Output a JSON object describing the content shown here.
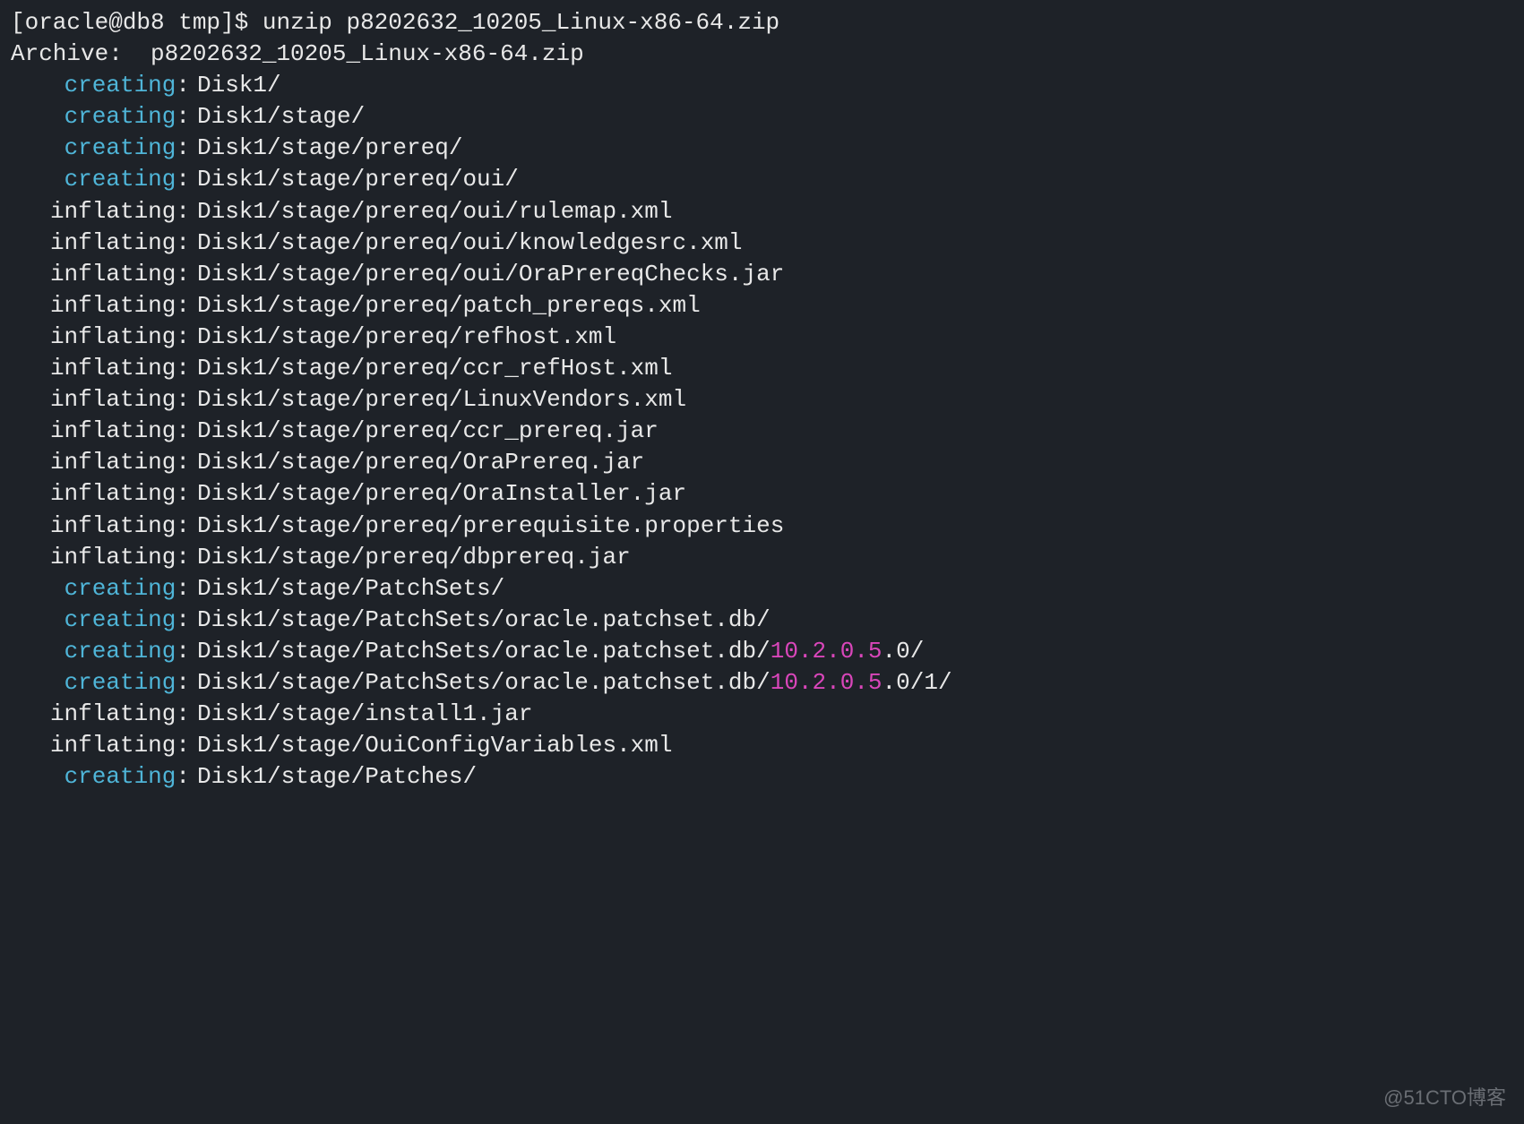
{
  "prompt": "[oracle@db8 tmp]$ ",
  "command": "unzip p8202632_10205_Linux-x86-64.zip",
  "archive_line": "Archive:  p8202632_10205_Linux-x86-64.zip",
  "lines": [
    {
      "action": "creating",
      "path": "Disk1/"
    },
    {
      "action": "creating",
      "path": "Disk1/stage/"
    },
    {
      "action": "creating",
      "path": "Disk1/stage/prereq/"
    },
    {
      "action": "creating",
      "path": "Disk1/stage/prereq/oui/"
    },
    {
      "action": "inflating",
      "path": "Disk1/stage/prereq/oui/rulemap.xml"
    },
    {
      "action": "inflating",
      "path": "Disk1/stage/prereq/oui/knowledgesrc.xml"
    },
    {
      "action": "inflating",
      "path": "Disk1/stage/prereq/oui/OraPrereqChecks.jar"
    },
    {
      "action": "inflating",
      "path": "Disk1/stage/prereq/patch_prereqs.xml"
    },
    {
      "action": "inflating",
      "path": "Disk1/stage/prereq/refhost.xml"
    },
    {
      "action": "inflating",
      "path": "Disk1/stage/prereq/ccr_refHost.xml"
    },
    {
      "action": "inflating",
      "path": "Disk1/stage/prereq/LinuxVendors.xml"
    },
    {
      "action": "inflating",
      "path": "Disk1/stage/prereq/ccr_prereq.jar"
    },
    {
      "action": "inflating",
      "path": "Disk1/stage/prereq/OraPrereq.jar"
    },
    {
      "action": "inflating",
      "path": "Disk1/stage/prereq/OraInstaller.jar"
    },
    {
      "action": "inflating",
      "path": "Disk1/stage/prereq/prerequisite.properties"
    },
    {
      "action": "inflating",
      "path": "Disk1/stage/prereq/dbprereq.jar"
    },
    {
      "action": "creating",
      "path": "Disk1/stage/PatchSets/"
    },
    {
      "action": "creating",
      "path": "Disk1/stage/PatchSets/oracle.patchset.db/"
    },
    {
      "action": "creating",
      "path_prefix": "Disk1/stage/PatchSets/oracle.patchset.db/",
      "version": "10.2.0.5",
      "path_suffix": ".0/"
    },
    {
      "action": "creating",
      "path_prefix": "Disk1/stage/PatchSets/oracle.patchset.db/",
      "version": "10.2.0.5",
      "path_suffix": ".0/1/"
    },
    {
      "action": "inflating",
      "path": "Disk1/stage/install1.jar"
    },
    {
      "action": "inflating",
      "path": "Disk1/stage/OuiConfigVariables.xml"
    },
    {
      "action": "creating",
      "path": "Disk1/stage/Patches/"
    }
  ],
  "watermark": "@51CTO博客"
}
